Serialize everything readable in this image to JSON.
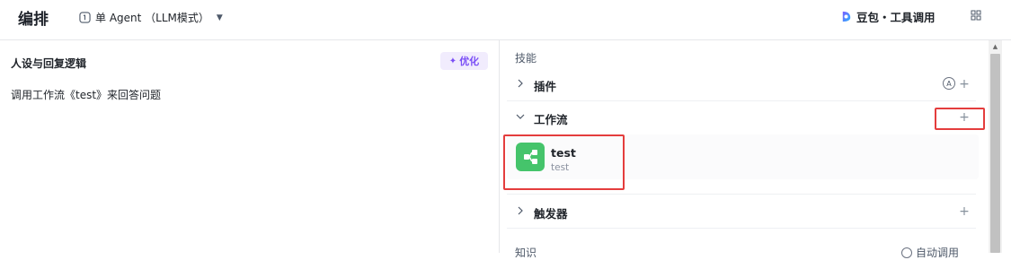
{
  "header": {
    "title": "编排",
    "mode_label": "单 Agent （LLM模式）",
    "model_label": "豆包・工具调用"
  },
  "persona": {
    "heading": "人设与回复逻辑",
    "optimize_label": "优化",
    "prompt_text": "调用工作流《test》来回答问题"
  },
  "skills": {
    "section_label": "技能",
    "plugins_label": "插件",
    "auto_badge": "A",
    "workflow_label": "工作流",
    "workflow_item": {
      "name": "test",
      "description": "test"
    },
    "trigger_label": "触发器"
  },
  "bottom": {
    "section_label": "知识",
    "right_label": "自动调用"
  },
  "colors": {
    "accent_purple": "#7a4ef6",
    "workflow_green": "#45c46b",
    "highlight_red": "#e43d3d"
  }
}
